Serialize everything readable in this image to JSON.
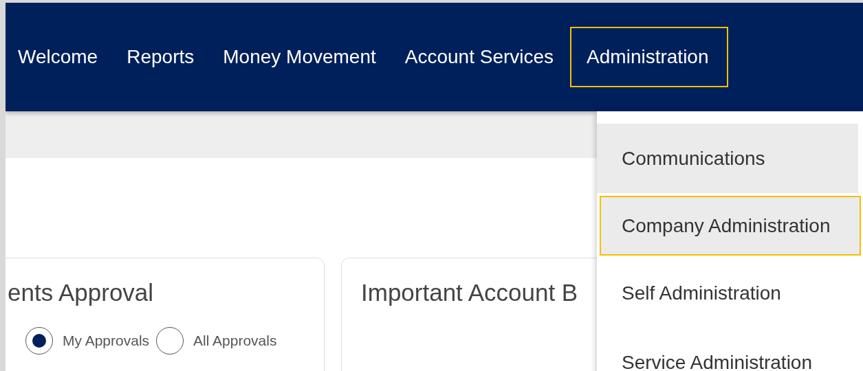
{
  "nav": {
    "tabs": [
      {
        "label": "Welcome",
        "selected": false
      },
      {
        "label": "Reports",
        "selected": false
      },
      {
        "label": "Money Movement",
        "selected": false
      },
      {
        "label": "Account Services",
        "selected": false
      },
      {
        "label": "Administration",
        "selected": true
      }
    ]
  },
  "cards": [
    {
      "title": "ents Approval",
      "radios": [
        {
          "label": "My Approvals",
          "selected": true
        },
        {
          "label": "All Approvals",
          "selected": false
        }
      ]
    },
    {
      "title": "Important Account B"
    }
  ],
  "dropdown": {
    "items": [
      {
        "label": "Communications",
        "hovered": true,
        "selected": false
      },
      {
        "label": "Company Administration",
        "hovered": true,
        "selected": true
      },
      {
        "label": "Self Administration",
        "hovered": false,
        "selected": false
      },
      {
        "label": "Service Administration",
        "hovered": false,
        "selected": false
      }
    ]
  }
}
